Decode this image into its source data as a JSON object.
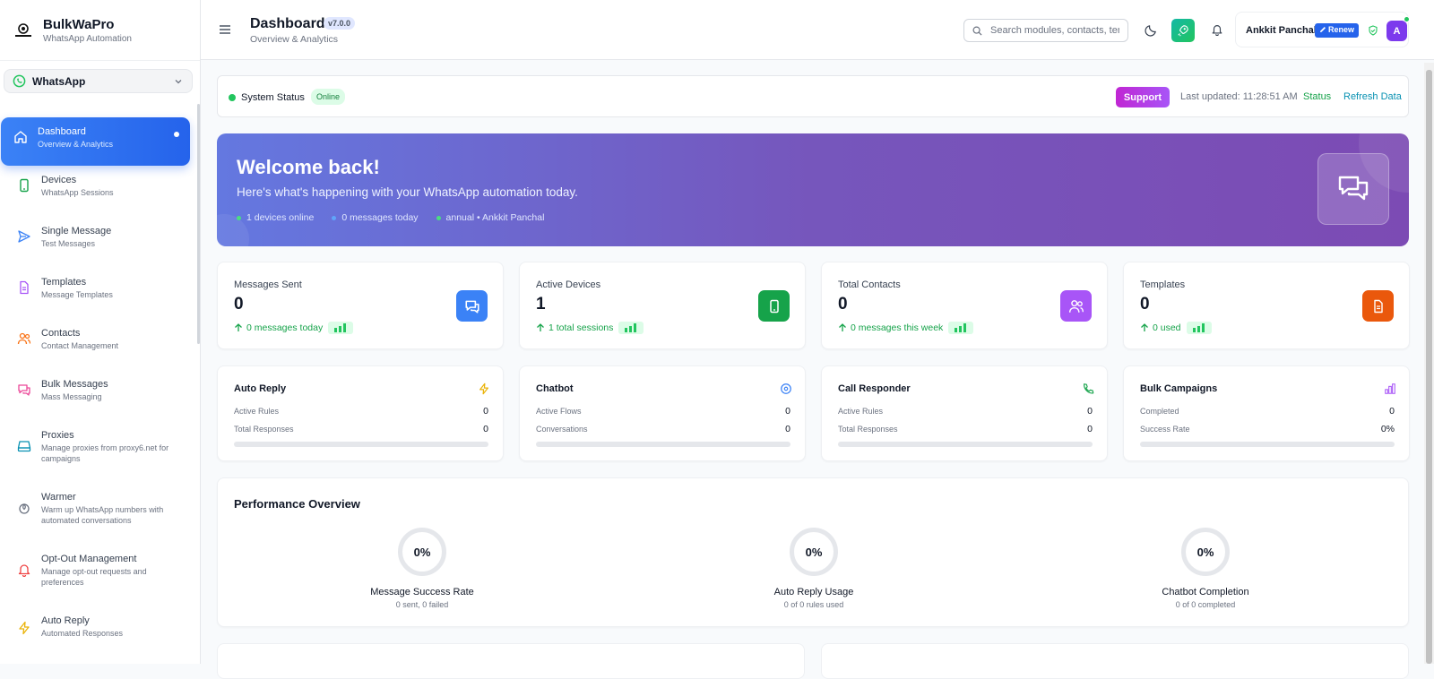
{
  "app": {
    "name": "BulkWaPro",
    "tagline": "WhatsApp Automation"
  },
  "workspace": {
    "label": "WhatsApp"
  },
  "sidebar": {
    "items": [
      {
        "label": "Dashboard",
        "sub": "Overview & Analytics",
        "icon": "home-icon"
      },
      {
        "label": "Devices",
        "sub": "WhatsApp Sessions",
        "icon": "phone-icon"
      },
      {
        "label": "Single Message",
        "sub": "Test Messages",
        "icon": "send-icon"
      },
      {
        "label": "Templates",
        "sub": "Message Templates",
        "icon": "file-icon"
      },
      {
        "label": "Contacts",
        "sub": "Contact Management",
        "icon": "users-icon"
      },
      {
        "label": "Bulk Messages",
        "sub": "Mass Messaging",
        "icon": "messages-icon"
      },
      {
        "label": "Proxies",
        "sub": "Manage proxies from proxy6.net for campaigns",
        "icon": "proxy-icon"
      },
      {
        "label": "Warmer",
        "sub": "Warm up WhatsApp numbers with automated conversations",
        "icon": "flame-icon"
      },
      {
        "label": "Opt-Out Management",
        "sub": "Manage opt-out requests and preferences",
        "icon": "bell-off-icon"
      },
      {
        "label": "Auto Reply",
        "sub": "Automated Responses",
        "icon": "bolt-icon"
      }
    ]
  },
  "header": {
    "title": "Dashboard",
    "version": "v7.0.0",
    "subtitle": "Overview & Analytics",
    "search_placeholder": "Search modules, contacts, templates...",
    "user_name": "Ankkit Panchal",
    "renew_label": "Renew",
    "avatar_initial": "A"
  },
  "status": {
    "label": "System Status",
    "badge": "Online",
    "support_label": "Support",
    "last_updated": "Last updated: 11:28:51 AM",
    "status_link": "Status",
    "refresh_link": "Refresh Data"
  },
  "banner": {
    "title": "Welcome back!",
    "subtitle": "Here's what's happening with your WhatsApp automation today.",
    "stat1": "1 devices online",
    "stat2": "0 messages today",
    "stat3": "annual • Ankkit Panchal"
  },
  "stats": [
    {
      "title": "Messages Sent",
      "value": "0",
      "note": "0 messages today",
      "color": "#3b82f6"
    },
    {
      "title": "Active Devices",
      "value": "1",
      "note": "1 total sessions",
      "color": "#16a34a"
    },
    {
      "title": "Total Contacts",
      "value": "0",
      "note": "0 messages this week",
      "color": "#a855f7"
    },
    {
      "title": "Templates",
      "value": "0",
      "note": "0 used",
      "color": "#ea580c"
    }
  ],
  "modules": [
    {
      "title": "Auto Reply",
      "row1_label": "Active Rules",
      "row1_value": "0",
      "row2_label": "Total Responses",
      "row2_value": "0"
    },
    {
      "title": "Chatbot",
      "row1_label": "Active Flows",
      "row1_value": "0",
      "row2_label": "Conversations",
      "row2_value": "0"
    },
    {
      "title": "Call Responder",
      "row1_label": "Active Rules",
      "row1_value": "0",
      "row2_label": "Total Responses",
      "row2_value": "0"
    },
    {
      "title": "Bulk Campaigns",
      "row1_label": "Completed",
      "row1_value": "0",
      "row2_label": "Success Rate",
      "row2_value": "0%"
    }
  ],
  "performance": {
    "title": "Performance Overview",
    "gauges": [
      {
        "value": "0%",
        "label": "Message Success Rate",
        "sub": "0 sent, 0 failed"
      },
      {
        "value": "0%",
        "label": "Auto Reply Usage",
        "sub": "0 of 0 rules used"
      },
      {
        "value": "0%",
        "label": "Chatbot Completion",
        "sub": "0 of 0 completed"
      }
    ]
  }
}
